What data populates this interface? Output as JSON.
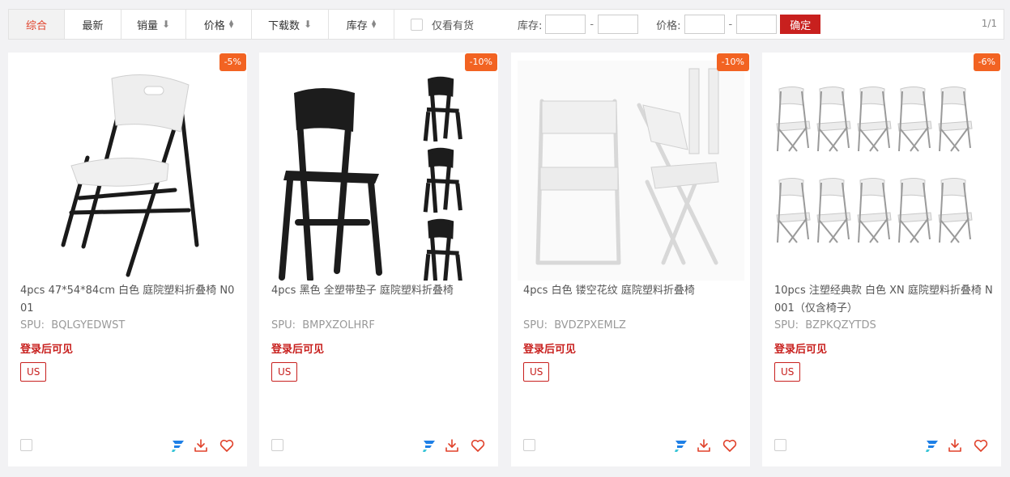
{
  "toolbar": {
    "sort_comprehensive": "综合",
    "sort_newest": "最新",
    "sort_sales": "销量",
    "sort_price": "价格",
    "sort_downloads": "下载数",
    "sort_stock": "库存",
    "in_stock_only": "仅看有货",
    "stock_label": "库存:",
    "price_label": "价格:",
    "range_dash": "-",
    "confirm": "确定",
    "page_indicator": "1/1"
  },
  "colors": {
    "accent_red": "#c8201e",
    "discount_orange": "#f26322",
    "icon_blue": "#1e7fe6"
  },
  "products": [
    {
      "discount": "-5%",
      "title": "4pcs 47*54*84cm 白色 庭院塑料折叠椅 N001",
      "spu_label": "SPU:",
      "spu": "BQLGYEDWST",
      "price_notice": "登录后可见",
      "region_tag": "US",
      "image_icon": "white-black-folding-chair"
    },
    {
      "discount": "-10%",
      "title": "4pcs 黑色 全塑带垫子 庭院塑料折叠椅",
      "spu_label": "SPU:",
      "spu": "BMPXZOLHRF",
      "price_notice": "登录后可见",
      "region_tag": "US",
      "image_icon": "black-folding-chairs"
    },
    {
      "discount": "-10%",
      "title": "4pcs 白色 镂空花纹 庭院塑料折叠椅",
      "spu_label": "SPU:",
      "spu": "BVDZPXEMLZ",
      "price_notice": "登录后可见",
      "region_tag": "US",
      "image_icon": "white-mesh-folding-chairs"
    },
    {
      "discount": "-6%",
      "title": "10pcs 注塑经典款 白色 XN 庭院塑料折叠椅 N001（仅含椅子）",
      "spu_label": "SPU:",
      "spu": "BZPKQZYTDS",
      "price_notice": "登录后可见",
      "region_tag": "US",
      "image_icon": "ten-white-folding-chairs"
    }
  ]
}
